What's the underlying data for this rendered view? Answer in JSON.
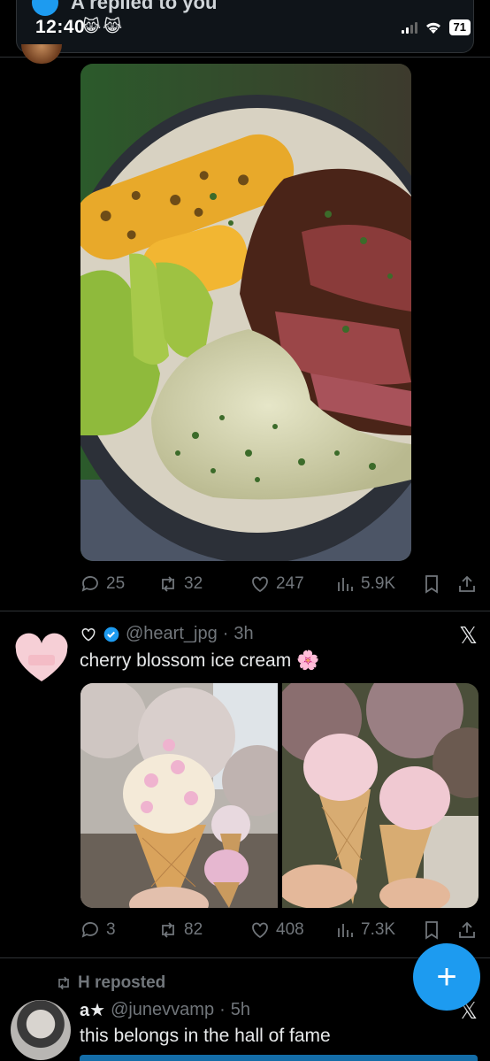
{
  "notification": {
    "text": "A replied to you"
  },
  "status_bar": {
    "time": "12:40",
    "emoji": [
      "😹",
      "😹"
    ],
    "battery": "71"
  },
  "tweet1": {
    "stats": {
      "replies": "25",
      "reposts": "32",
      "likes": "247",
      "views": "5.9K"
    }
  },
  "tweet2": {
    "handle": "@heart_jpg",
    "separator": "·",
    "time": "3h",
    "text": "cherry blossom ice cream",
    "text_emoji": "🌸",
    "stats": {
      "replies": "3",
      "reposts": "82",
      "likes": "408",
      "views": "7.3K"
    }
  },
  "tweet3": {
    "repost_label": "H reposted",
    "name": "a★",
    "handle": "@junevvamp",
    "separator": "·",
    "time": "5h",
    "text": "this belongs in the hall of fame"
  },
  "fab": {
    "label": "+"
  },
  "x_logo": "𝕏",
  "colors": {
    "accent": "#1d9bf0",
    "muted": "#71767b",
    "background": "#000000"
  }
}
